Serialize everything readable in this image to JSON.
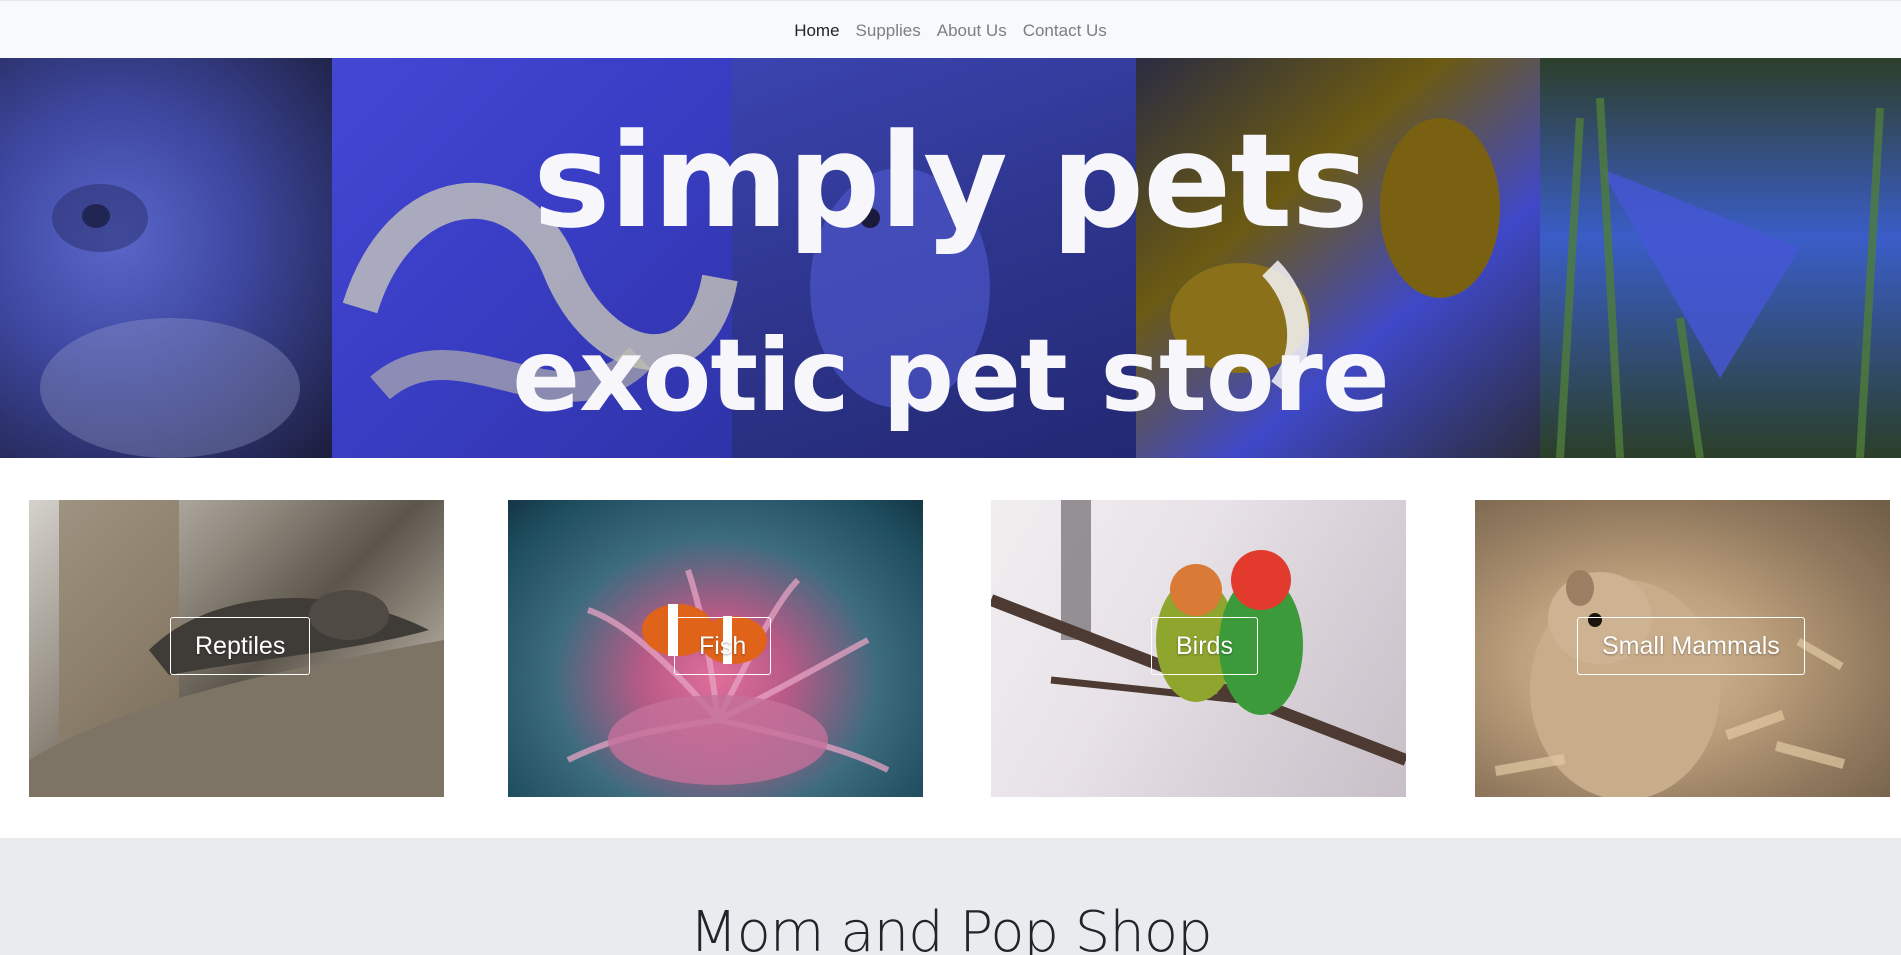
{
  "nav": {
    "items": [
      {
        "label": "Home",
        "active": true
      },
      {
        "label": "Supplies",
        "active": false
      },
      {
        "label": "About Us",
        "active": false
      },
      {
        "label": "Contact Us",
        "active": false
      }
    ]
  },
  "hero": {
    "line1": "simply pets",
    "line2": "exotic pet store"
  },
  "categories": [
    {
      "label": "Reptiles",
      "image": "snake-on-branch"
    },
    {
      "label": "Fish",
      "image": "clownfish-in-anemone"
    },
    {
      "label": "Birds",
      "image": "lovebirds-on-branch"
    },
    {
      "label": "Small Mammals",
      "image": "gerbil-in-bedding"
    }
  ],
  "section": {
    "title": "Mom and Pop Shop"
  },
  "colors": {
    "nav_bg": "#f8f9fa",
    "nav_active": "#212529",
    "nav_inactive": "#7b7f84",
    "section_bg": "#e9ecef"
  }
}
